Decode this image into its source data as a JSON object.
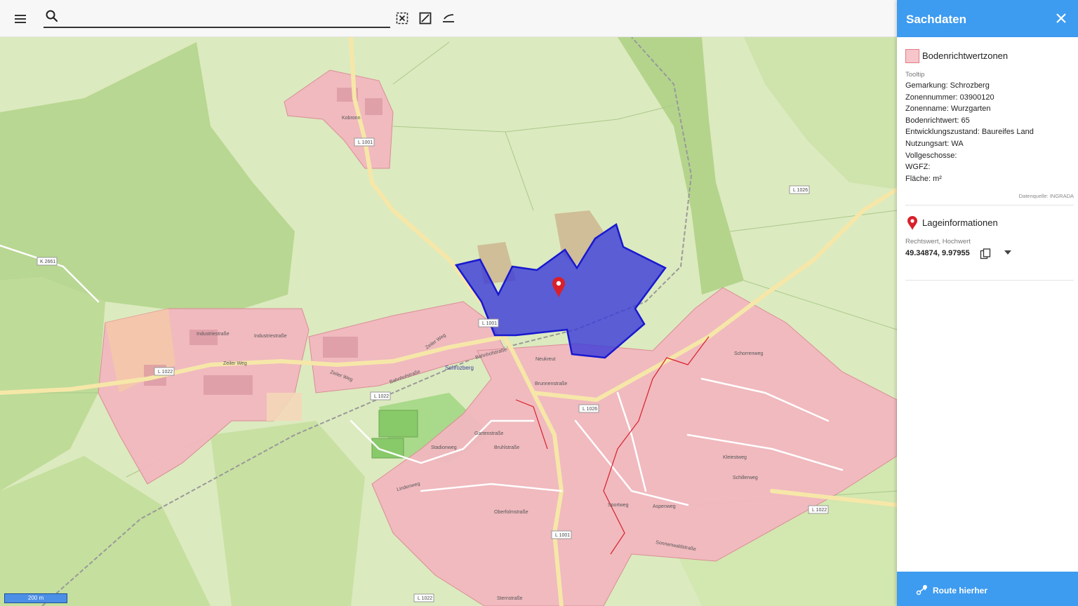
{
  "toolbar": {
    "search": {
      "value": "",
      "placeholder": ""
    },
    "icons": [
      "menu-icon",
      "search-icon",
      "select-area-icon",
      "draw-polygon-icon",
      "measure-line-icon"
    ]
  },
  "map": {
    "place_labels": {
      "kobronn": "Kobronn",
      "schrozberg": "Schrozberg",
      "industriestrasse_1": "Industriestraße",
      "industriestrasse_2": "Industriestraße",
      "zeiler_weg_1": "Zeiler Weg",
      "zeiler_weg_2": "Zeiler Weg",
      "zeiler_weg_3": "Zeiler Weg",
      "bahnhofstrasse_1": "Bahnhofstraße",
      "bahnhofstrasse_2": "Bahnhofstraße",
      "neukreut": "Neukreut",
      "brunnenstrasse": "Brunnenstraße",
      "gartenstrasse": "Gartenstraße",
      "bruehlstrasse": "Bruhlstraße",
      "stadionweg": "Stadionweg",
      "lindenweg": "Lindenweg",
      "schillerweg": "Schillerweg",
      "schorrenweg": "Schorrenweg",
      "kleiestweg": "Kleiestweg",
      "aspenweg": "Aspenweg",
      "sternstrasse": "Sternstraße",
      "sonnenwaldstrasse": "Sonnenwaldstraße",
      "oberfolmstrasse": "Oberfolmstraße",
      "sportweg": "Sportweg"
    },
    "road_shields": {
      "l1001_north": "L 1001",
      "l1001_center": "L 1001",
      "l1001_south": "L 1001",
      "l1026_east": "L 1026",
      "l1026_center": "L 1026",
      "l1022_west": "L 1022",
      "l1022_center": "L 1022",
      "l1022_south": "L 1022",
      "l1022_east": "L 1022",
      "k2661": "K 2661"
    },
    "selected_zone_color": "#3a3ad9",
    "zone_fill_color": "#f2b8c0",
    "marker_color": "#d9202a",
    "scale_label": "200 m"
  },
  "panel": {
    "title": "Sachdaten",
    "layer": {
      "name": "Bodenrichtwertzonen",
      "tooltip_label": "Tooltip",
      "attributes": [
        "Gemarkung: Schrozberg",
        "Zonennummer: 03900120",
        "Zonenname: Wurzgarten",
        "Bodenrichtwert: 65",
        "Entwicklungszustand: Baureifes Land",
        "Nutzungsart: WA",
        "Vollgeschosse:",
        "WGFZ:",
        "Fläche: m²"
      ],
      "source": "Datenquelle: INGRADA"
    },
    "location": {
      "title": "Lageinformationen",
      "coord_label": "Rechtswert, Hochwert",
      "coord_value": "49.34874, 9.97955"
    },
    "route_button": "Route hierher",
    "accent_color": "#3d9bf0"
  }
}
